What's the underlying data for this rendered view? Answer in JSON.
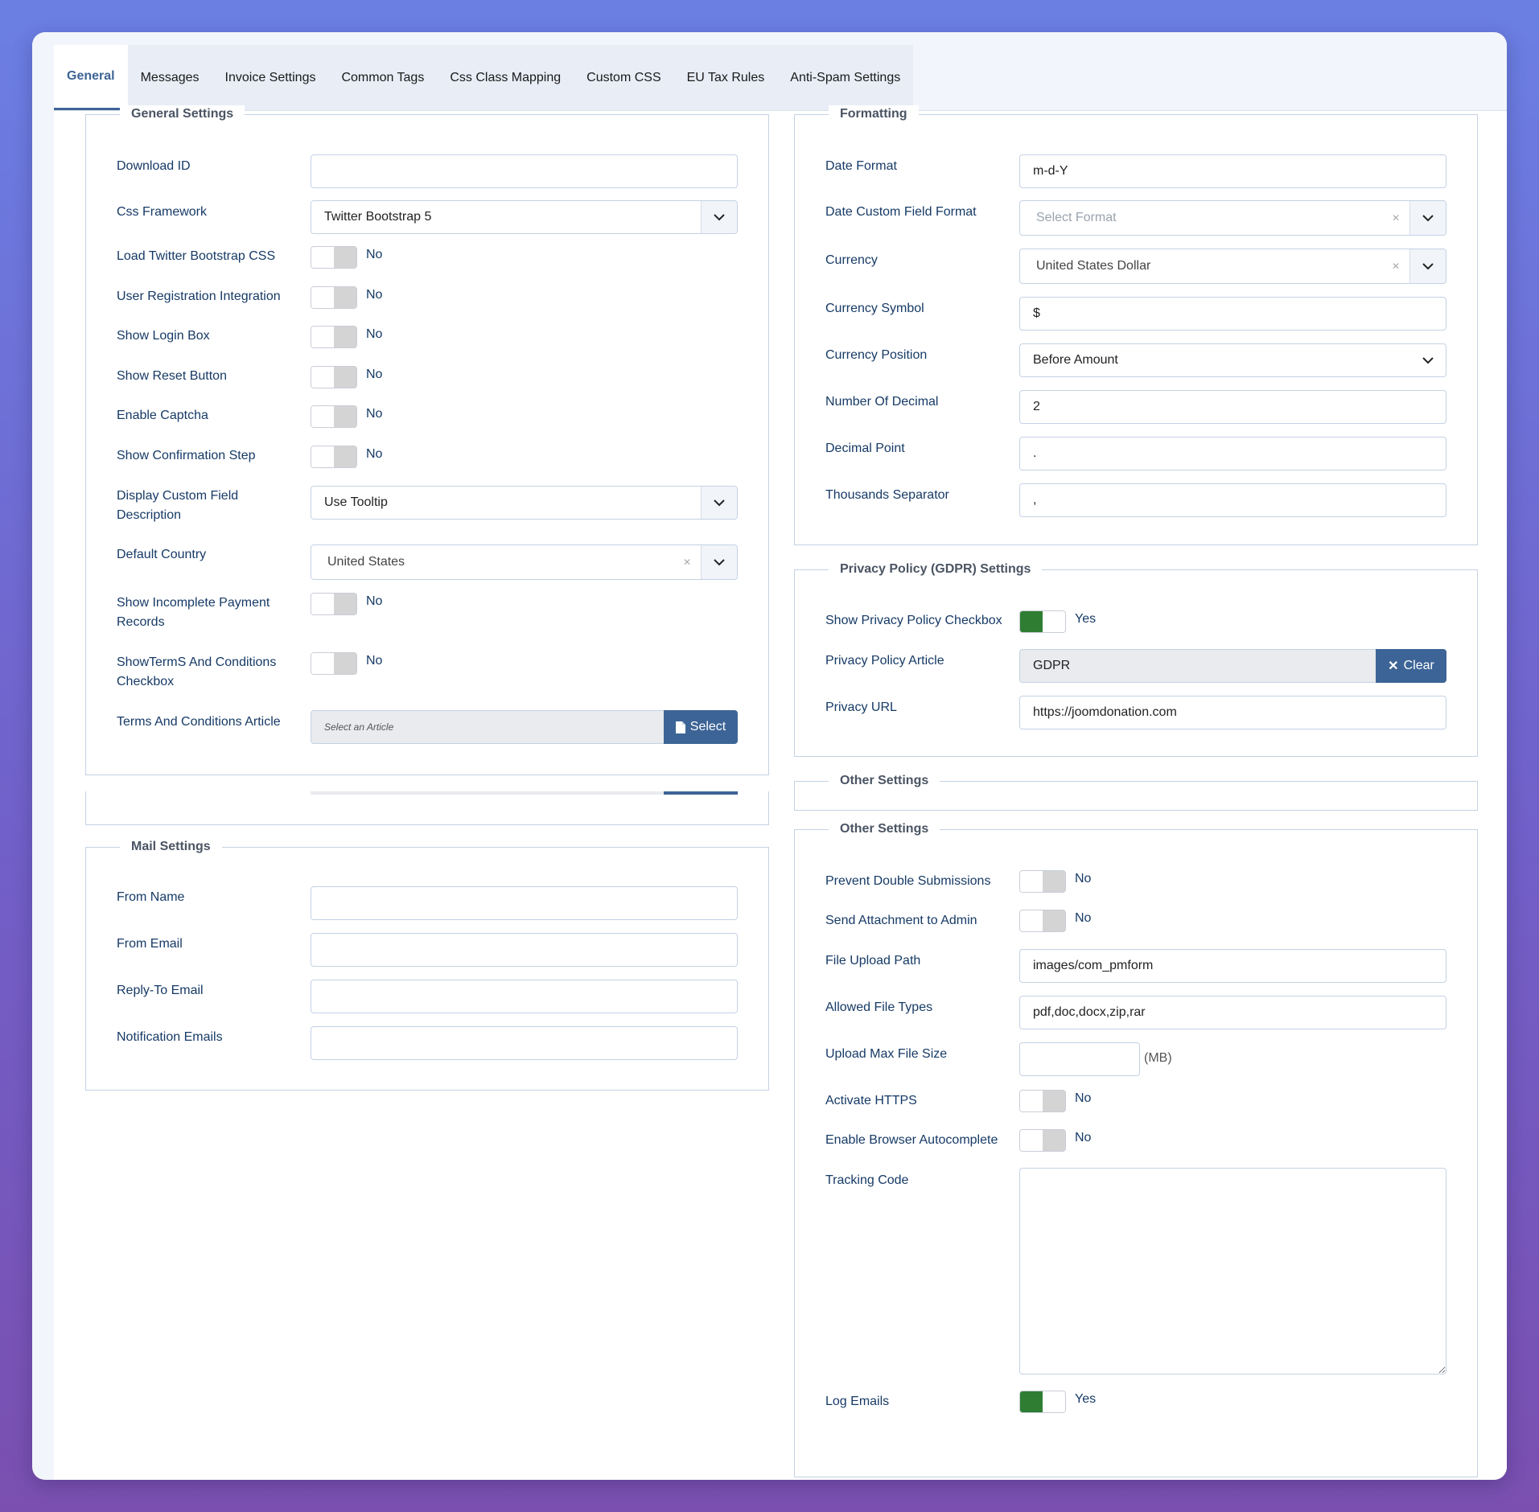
{
  "tabs": [
    "General",
    "Messages",
    "Invoice Settings",
    "Common Tags",
    "Css Class Mapping",
    "Custom CSS",
    "EU Tax Rules",
    "Anti-Spam Settings"
  ],
  "general": {
    "legend": "General Settings",
    "download_id": {
      "label": "Download ID",
      "value": ""
    },
    "css_framework": {
      "label": "Css Framework",
      "value": "Twitter Bootstrap 5"
    },
    "load_bootstrap": {
      "label": "Load Twitter Bootstrap CSS",
      "state": "No"
    },
    "user_registration": {
      "label": "User Registration Integration",
      "state": "No"
    },
    "show_login": {
      "label": "Show Login Box",
      "state": "No"
    },
    "show_reset": {
      "label": "Show Reset Button",
      "state": "No"
    },
    "enable_captcha": {
      "label": "Enable Captcha",
      "state": "No"
    },
    "show_confirmation": {
      "label": "Show Confirmation Step",
      "state": "No"
    },
    "display_custom_desc": {
      "label1": "Display Custom Field",
      "label2": "Description",
      "value": "Use Tooltip"
    },
    "default_country": {
      "label": "Default Country",
      "value": "United States"
    },
    "show_incomplete": {
      "label1": "Show Incomplete Payment",
      "label2": "Records",
      "state": "No"
    },
    "show_terms": {
      "label1": "ShowTermS And Conditions",
      "label2": "Checkbox",
      "state": "No"
    },
    "terms_article": {
      "label": "Terms And Conditions Article",
      "placeholder": "Select an Article",
      "button": "Select"
    }
  },
  "mail": {
    "legend": "Mail Settings",
    "from_name": {
      "label": "From Name",
      "value": ""
    },
    "from_email": {
      "label": "From Email",
      "value": ""
    },
    "reply_to": {
      "label": "Reply-To Email",
      "value": ""
    },
    "notification": {
      "label": "Notification Emails",
      "value": ""
    }
  },
  "formatting": {
    "legend": "Formatting",
    "date_format": {
      "label": "Date Format",
      "value": "m-d-Y"
    },
    "date_custom": {
      "label": "Date Custom Field Format",
      "placeholder": "Select Format"
    },
    "currency": {
      "label": "Currency",
      "value": "United States Dollar"
    },
    "currency_symbol": {
      "label": "Currency Symbol",
      "value": "$"
    },
    "currency_position": {
      "label": "Currency Position",
      "value": "Before Amount"
    },
    "num_decimal": {
      "label": "Number Of Decimal",
      "value": "2"
    },
    "decimal_point": {
      "label": "Decimal Point",
      "value": "."
    },
    "thousands_sep": {
      "label": "Thousands Separator",
      "value": ","
    }
  },
  "gdpr": {
    "legend": "Privacy Policy (GDPR) Settings",
    "show_checkbox": {
      "label": "Show Privacy Policy Checkbox",
      "state": "Yes"
    },
    "article": {
      "label": "Privacy Policy Article",
      "value": "GDPR",
      "button": "Clear"
    },
    "privacy_url": {
      "label": "Privacy URL",
      "value": "https://joomdonation.com"
    }
  },
  "other_collapsed": {
    "legend": "Other Settings"
  },
  "other": {
    "legend": "Other Settings",
    "prevent_double": {
      "label": "Prevent Double Submissions",
      "state": "No"
    },
    "send_attachment": {
      "label": "Send Attachment to Admin",
      "state": "No"
    },
    "upload_path": {
      "label": "File Upload Path",
      "value": "images/com_pmform"
    },
    "allowed_types": {
      "label": "Allowed File Types",
      "value": "pdf,doc,docx,zip,rar"
    },
    "max_size": {
      "label": "Upload Max File Size",
      "value": "",
      "unit": "(MB)"
    },
    "https": {
      "label": "Activate HTTPS",
      "state": "No"
    },
    "autocomplete": {
      "label": "Enable Browser Autocomplete",
      "state": "No"
    },
    "tracking": {
      "label": "Tracking Code",
      "value": ""
    },
    "log_emails": {
      "label": "Log Emails",
      "state": "Yes"
    }
  },
  "icons": {
    "chevron": "chevron-down-icon",
    "clear": "clear-x-icon",
    "file": "file-icon",
    "close": "close-icon"
  },
  "colors": {
    "accent": "#3d6496",
    "toggle_on": "#2e7d32",
    "label": "#163a66"
  }
}
